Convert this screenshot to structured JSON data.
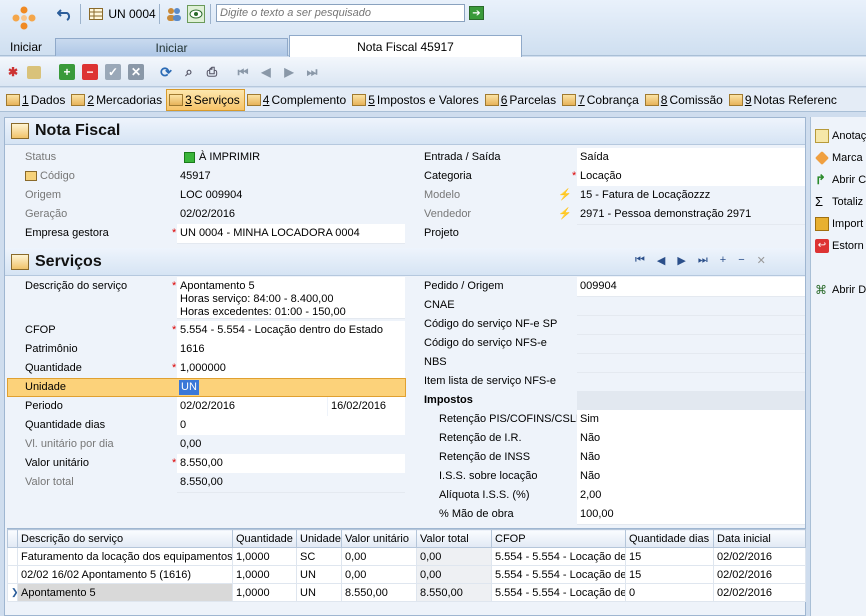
{
  "window": {
    "unit_label": "UN 0004",
    "search_placeholder": "Digite o texto a ser pesquisado",
    "iniciar_label": "Iniciar"
  },
  "tabs": {
    "home": "Iniciar",
    "doc": "Nota Fiscal 45917"
  },
  "subtabs": [
    {
      "num": "1",
      "label": " Dados"
    },
    {
      "num": "2",
      "label": " Mercadorias"
    },
    {
      "num": "3",
      "label": " Serviços"
    },
    {
      "num": "4",
      "label": " Complemento"
    },
    {
      "num": "5",
      "label": " Impostos e Valores"
    },
    {
      "num": "6",
      "label": " Parcelas"
    },
    {
      "num": "7",
      "label": " Cobrança"
    },
    {
      "num": "8",
      "label": " Comissão"
    },
    {
      "num": "9",
      "label": " Notas Referenc"
    }
  ],
  "nota": {
    "title": "Nota Fiscal",
    "status_label": "Status",
    "status_value": "À IMPRIMIR",
    "codigo_label": "Código",
    "codigo_value": "45917",
    "origem_label": "Origem",
    "origem_value": "LOC 009904",
    "geracao_label": "Geração",
    "geracao_value": "02/02/2016",
    "empresa_label": "Empresa gestora",
    "empresa_value": "UN 0004 - MINHA LOCADORA 0004",
    "entrada_label": "Entrada / Saída",
    "entrada_value": "Saída",
    "categoria_label": "Categoria",
    "categoria_value": "Locação",
    "modelo_label": "Modelo",
    "modelo_value": "15 - Fatura de Locaçãozzz",
    "vendedor_label": "Vendedor",
    "vendedor_value": "2971 - Pessoa demonstração 2971",
    "projeto_label": "Projeto",
    "projeto_value": ""
  },
  "servicos": {
    "title": "Serviços",
    "descricao_label": "Descrição do serviço",
    "descricao_line1": "Apontamento 5",
    "descricao_line2": "Horas serviço: 84:00 - 8.400,00",
    "descricao_line3": "Horas excedentes: 01:00 - 150,00",
    "cfop_label": "CFOP",
    "cfop_value": "5.554 - 5.554 - Locação dentro do Estado",
    "patrimonio_label": "Patrimônio",
    "patrimonio_value": "1616",
    "quantidade_label": "Quantidade",
    "quantidade_value": "1,000000",
    "unidade_label": "Unidade",
    "unidade_value": "UN",
    "periodo_label": "Periodo",
    "periodo_from": "02/02/2016",
    "periodo_to": "16/02/2016",
    "qtd_dias_label": "Quantidade dias",
    "qtd_dias_value": "0",
    "vl_unit_dia_label": "Vl. unitário por dia",
    "vl_unit_dia_value": "0,00",
    "valor_unit_label": "Valor unitário",
    "valor_unit_value": "8.550,00",
    "valor_total_label": "Valor total",
    "valor_total_value": "8.550,00",
    "pedido_label": "Pedido / Origem",
    "pedido_value": "009904",
    "cnae_label": "CNAE",
    "cod_nfe_sp_label": "Código do serviço NF-e SP",
    "cod_nfse_label": "Código do serviço NFS-e",
    "nbs_label": "NBS",
    "item_lista_label": "Item lista de serviço NFS-e",
    "impostos_label": "Impostos",
    "ret_pis_label": "Retenção PIS/COFINS/CSLL",
    "ret_pis_value": "Sim",
    "ret_ir_label": "Retenção de I.R.",
    "ret_ir_value": "Não",
    "ret_inss_label": "Retenção de INSS",
    "ret_inss_value": "Não",
    "iss_loc_label": "I.S.S. sobre locação",
    "iss_loc_value": "Não",
    "aliq_iss_label": "Alíquota I.S.S. (%)",
    "aliq_iss_value": "2,00",
    "mao_obra_label": "% Mão de obra",
    "mao_obra_value": "100,00"
  },
  "grid": {
    "columns": [
      "Descrição do serviço",
      "Quantidade",
      "Unidade",
      "Valor unitário",
      "Valor total",
      "CFOP",
      "Quantidade dias",
      "Data inicial"
    ],
    "rows": [
      [
        "Faturamento da locação dos equipamentos",
        "1,0000",
        "SC",
        "0,00",
        "0,00",
        "5.554 - 5.554 - Locação de",
        "15",
        "02/02/2016"
      ],
      [
        "02/02 16/02 Apontamento 5  (1616)",
        "1,0000",
        "UN",
        "0,00",
        "0,00",
        "5.554 - 5.554 - Locação de",
        "15",
        "02/02/2016"
      ],
      [
        "Apontamento 5",
        "1,0000",
        "UN",
        "8.550,00",
        "8.550,00",
        "5.554 - 5.554 - Locação de",
        "0",
        "02/02/2016"
      ]
    ]
  },
  "right_actions": [
    "Anotaç",
    "Marca",
    "Abrir C",
    "Totaliz",
    "Import",
    "Estorn",
    "Abrir D"
  ]
}
